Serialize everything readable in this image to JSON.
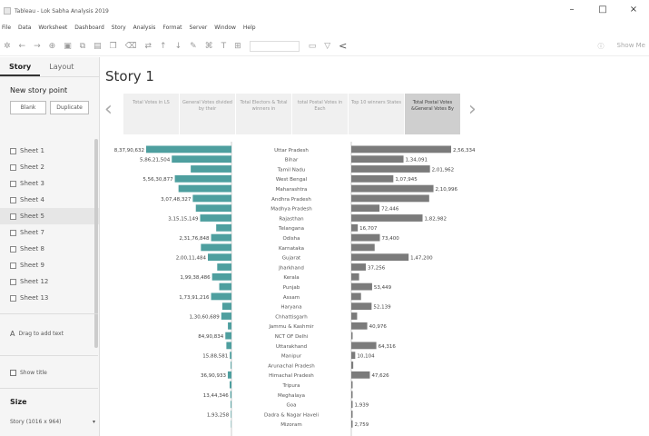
{
  "window": {
    "title": "Tableau - Lok Sabha Analysis 2019",
    "minimize": "–",
    "maximize": "□",
    "close": "×"
  },
  "menu": [
    "File",
    "Data",
    "Worksheet",
    "Dashboard",
    "Story",
    "Analysis",
    "Format",
    "Server",
    "Window",
    "Help"
  ],
  "toolbar": {
    "share_glyph": "<",
    "show_me": "Show Me"
  },
  "left_pane": {
    "tabs": [
      "Story",
      "Layout"
    ],
    "new_story_heading": "New story point",
    "blank_label": "Blank",
    "duplicate_label": "Duplicate",
    "sheets": [
      "Sheet 1",
      "Sheet 2",
      "Sheet 3",
      "Sheet 4",
      "Sheet 5",
      "Sheet 7",
      "Sheet 8",
      "Sheet 9",
      "Sheet 12",
      "Sheet 13"
    ],
    "active_sheet_index": 4,
    "drag_text": "Drag to add text",
    "show_title": "Show title",
    "size_heading": "Size",
    "size_value": "Story (1016 x 964)",
    "size_caret": "▾"
  },
  "story": {
    "title": "Story 1",
    "nav_points": [
      "Total Votes in LS",
      "General Votes divided by their",
      "Total Electors & Total winners in",
      "total Postal Votes in Each",
      "Top 10 winners States",
      "Total Postal Votes &General Votes By"
    ],
    "active_nav_index": 5,
    "prev_arrow": "‹",
    "next_arrow": "›"
  },
  "chart_data": {
    "type": "bar",
    "states": [
      "Uttar Pradesh",
      "Bihar",
      "Tamil Nadu",
      "West Bengal",
      "Maharashtra",
      "Andhra Pradesh",
      "Madhya Pradesh",
      "Rajasthan",
      "Telangana",
      "Odisha",
      "Karnataka",
      "Gujarat",
      "Jharkhand",
      "Kerala",
      "Punjab",
      "Assam",
      "Haryana",
      "Chhattisgarh",
      "Jammu & Kashmir",
      "NCT OF Delhi",
      "Uttarakhand",
      "Manipur",
      "Arunachal Pradesh",
      "Himachal Pradesh",
      "Tripura",
      "Meghalaya",
      "Goa",
      "Dadra & Nagar Haveli",
      "Mizoram"
    ],
    "general_votes": [
      83790632,
      58621504,
      40000000,
      55630877,
      52000000,
      38000000,
      35000000,
      30748327,
      15000000,
      20000000,
      30000000,
      23176848,
      14000000,
      19000000,
      12000000,
      20011484,
      9000000,
      10000000,
      3500000,
      6000000,
      5000000,
      1600000,
      800000,
      3600000,
      1800000,
      1100000,
      800000,
      600000,
      400000
    ],
    "general_labels": [
      "8,37,90,632",
      "5,86,21,504",
      "",
      "5,56,30,877",
      "",
      "3,07,48,327",
      "",
      "3,15,15,149",
      "",
      "2,31,76,848",
      "",
      "2,00,11,484",
      "",
      "1,99,38,486",
      "",
      "1,73,91,216",
      "",
      "1,30,60,689",
      "",
      "84,90,834",
      "",
      "15,88,581",
      "",
      "36,90,933",
      "",
      "13,44,346",
      "",
      "1,93,258",
      ""
    ],
    "postal_votes": [
      256334,
      134091,
      201962,
      107945,
      210996,
      200000,
      72446,
      182982,
      16707,
      73400,
      60000,
      147200,
      37256,
      20000,
      53449,
      25000,
      52139,
      15000,
      40976,
      3000,
      64316,
      10104,
      5000,
      47626,
      2500,
      1000,
      1939,
      800,
      2759
    ],
    "postal_labels": [
      "2,56,334",
      "1,34,091",
      "2,01,962",
      "1,07,945",
      "2,10,996",
      "",
      "72,446",
      "1,82,982",
      "16,707",
      "73,400",
      "",
      "1,47,200",
      "37,256",
      "",
      "53,449",
      "",
      "52,139",
      "",
      "40,976",
      "",
      "64,316",
      "10,104",
      "",
      "47,626",
      "",
      "",
      "1,939",
      "",
      "2,759"
    ],
    "colors": {
      "general": "#4e9f9f",
      "postal": "#7b7b7b",
      "axis": "#cccccc"
    }
  }
}
